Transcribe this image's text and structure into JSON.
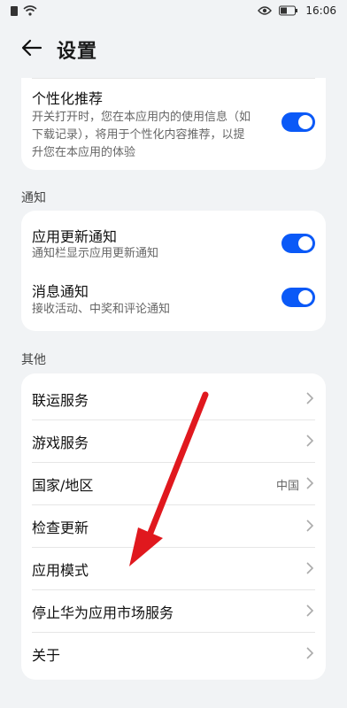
{
  "status_bar": {
    "time": "16:06",
    "icons": [
      "sim-icon",
      "wifi-icon",
      "eye-icon",
      "battery-icon"
    ]
  },
  "header": {
    "back_icon": "arrow-left-icon",
    "title": "设置"
  },
  "personalization": {
    "title": "个性化推荐",
    "description_lines": [
      "开关打开时，您在本应用内的使用信息（如",
      "下载记录），将用于个性化内容推荐，以提",
      "升您在本应用的体验"
    ],
    "enabled": true
  },
  "notifications": {
    "section_title": "通知",
    "items": [
      {
        "title": "应用更新通知",
        "description": "通知栏显示应用更新通知",
        "enabled": true
      },
      {
        "title": "消息通知",
        "description": "接收活动、中奖和评论通知",
        "enabled": true
      }
    ]
  },
  "others": {
    "section_title": "其他",
    "items": [
      {
        "label": "联运服务",
        "value": ""
      },
      {
        "label": "游戏服务",
        "value": ""
      },
      {
        "label": "国家/地区",
        "value": "中国"
      },
      {
        "label": "检查更新",
        "value": ""
      },
      {
        "label": "应用模式",
        "value": ""
      },
      {
        "label": "停止华为应用市场服务",
        "value": ""
      },
      {
        "label": "关于",
        "value": ""
      }
    ]
  },
  "colors": {
    "accent": "#0a59f7",
    "background": "#f1f3f5",
    "annotation_arrow": "#e0181e"
  }
}
